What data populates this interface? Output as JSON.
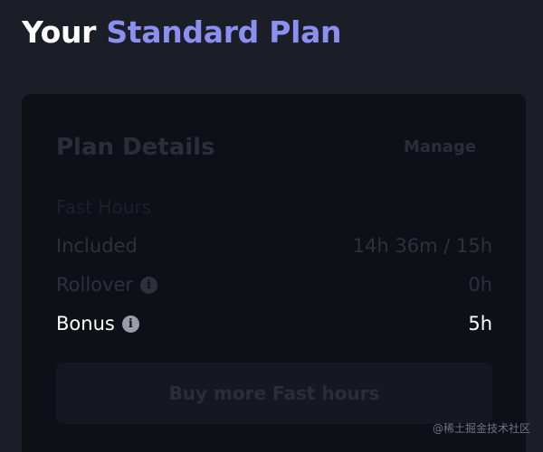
{
  "header": {
    "title_prefix": "Your",
    "title_highlight": "Standard Plan"
  },
  "plan_details": {
    "title": "Plan Details",
    "manage_label": "Manage",
    "section_heading": "Fast Hours",
    "rows": [
      {
        "label": "Included",
        "value": "14h 36m / 15h",
        "has_info_icon": false
      },
      {
        "label": "Rollover",
        "value": "0h",
        "has_info_icon": true,
        "icon": "info-icon"
      },
      {
        "label": "Bonus",
        "value": "5h",
        "has_info_icon": true,
        "icon": "info-icon"
      }
    ],
    "buy_button_label": "Buy more Fast hours"
  },
  "watermark": "@稀土掘金技术社区",
  "colors": {
    "background": "#1b1d27",
    "card": "#0e1018",
    "accent": "#8b8ff0",
    "text_primary": "#ffffff"
  }
}
